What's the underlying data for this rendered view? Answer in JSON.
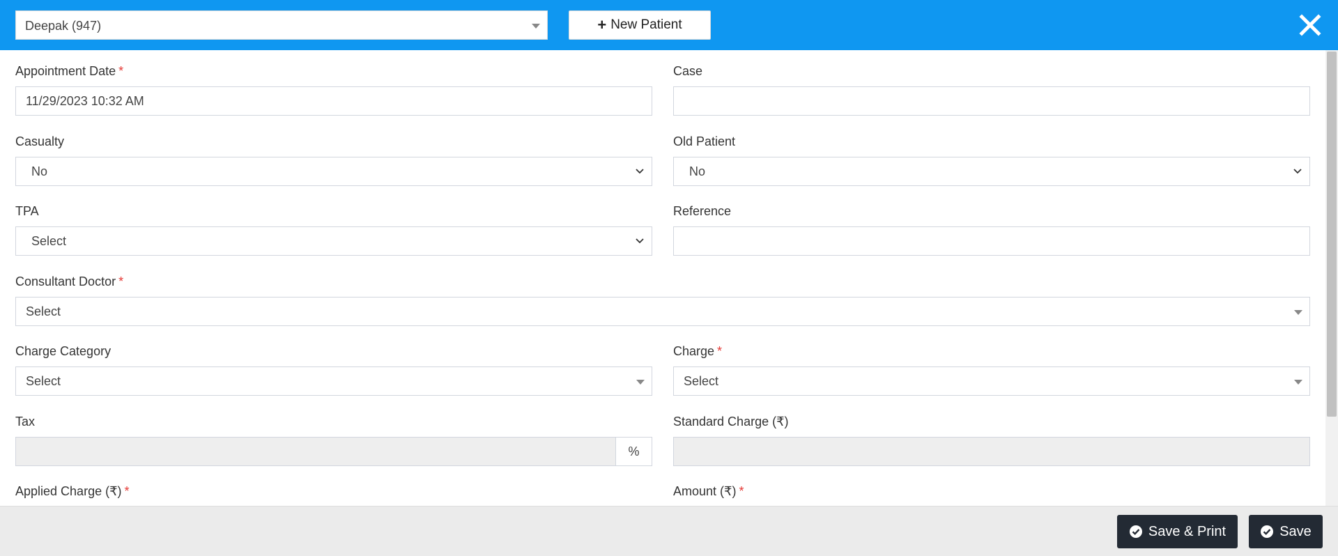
{
  "header": {
    "patient_select_value": "Deepak (947)",
    "new_patient_label": "New Patient"
  },
  "form": {
    "appointment_date": {
      "label": "Appointment Date",
      "required": "*",
      "value": "11/29/2023 10:32 AM"
    },
    "case": {
      "label": "Case",
      "value": ""
    },
    "casualty": {
      "label": "Casualty",
      "value": "No"
    },
    "old_patient": {
      "label": "Old Patient",
      "value": "No"
    },
    "tpa": {
      "label": "TPA",
      "value": "Select"
    },
    "reference": {
      "label": "Reference",
      "value": ""
    },
    "consultant_doctor": {
      "label": "Consultant Doctor",
      "required": "*",
      "value": "Select"
    },
    "charge_category": {
      "label": "Charge Category",
      "value": "Select"
    },
    "charge": {
      "label": "Charge",
      "required": "*",
      "value": "Select"
    },
    "tax": {
      "label": "Tax",
      "value": "",
      "addon": "%"
    },
    "standard_charge": {
      "label": "Standard Charge (₹)",
      "value": ""
    },
    "applied_charge": {
      "label": "Applied Charge (₹)",
      "required": "*"
    },
    "amount": {
      "label": "Amount (₹)",
      "required": "*"
    }
  },
  "footer": {
    "save_print_label": "Save & Print",
    "save_label": "Save"
  },
  "colors": {
    "header_bg": "#0f97f1",
    "required": "#e53935",
    "button_dark": "#232a34",
    "footer_bg": "#ebebeb"
  }
}
